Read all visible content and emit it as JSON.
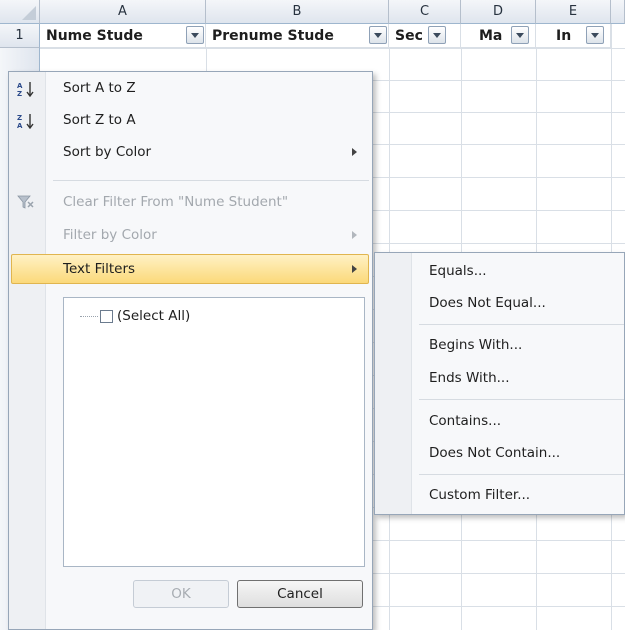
{
  "sheet": {
    "columns": [
      "A",
      "B",
      "C",
      "D",
      "E"
    ],
    "row_number": "1",
    "headers": [
      "Nume Stude",
      "Prenume Stude",
      "Sec",
      "Ma",
      "In"
    ]
  },
  "filter_menu": {
    "items": [
      {
        "label": "Sort A to Z",
        "icon": "sort-ascending-icon",
        "enabled": true
      },
      {
        "label": "Sort Z to A",
        "icon": "sort-descending-icon",
        "enabled": true
      },
      {
        "label": "Sort by Color",
        "enabled": true,
        "submenu": true
      },
      {
        "label": "Clear Filter From \"Nume Student\"",
        "icon": "clear-filter-icon",
        "enabled": false
      },
      {
        "label": "Filter by Color",
        "enabled": false,
        "submenu": true
      },
      {
        "label": "Text Filters",
        "enabled": true,
        "submenu": true,
        "highlighted": true
      }
    ],
    "select_all_label": "(Select All)",
    "ok_label": "OK",
    "cancel_label": "Cancel"
  },
  "text_filters_submenu": {
    "items": [
      "Equals...",
      "Does Not Equal...",
      "Begins With...",
      "Ends With...",
      "Contains...",
      "Does Not Contain...",
      "Custom Filter..."
    ]
  },
  "colors": {
    "highlight": "#fbd97a",
    "header_gradient": "#dfe5ee"
  }
}
